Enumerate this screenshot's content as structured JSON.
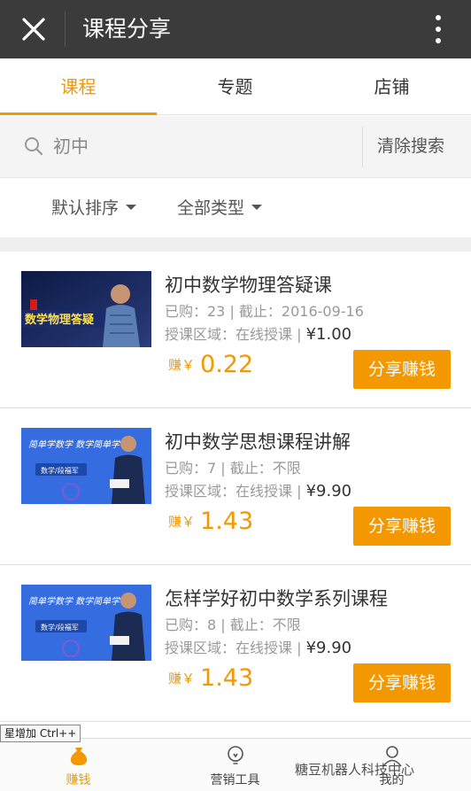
{
  "header": {
    "title": "课程分享",
    "close_icon": "close-icon",
    "more_icon": "more-vertical-icon"
  },
  "tabs": [
    {
      "label": "课程",
      "active": true
    },
    {
      "label": "专题",
      "active": false
    },
    {
      "label": "店铺",
      "active": false
    }
  ],
  "search": {
    "value": "初中",
    "clear_label": "清除搜索"
  },
  "filters": {
    "sort_label": "默认排序",
    "type_label": "全部类型"
  },
  "courses": [
    {
      "title": "初中数学物理答疑课",
      "meta": "已购：23 | 截止：2016-09-16",
      "region": "授课区域：在线授课 | ",
      "price": "¥1.00",
      "earn_label": "赚￥",
      "earn": "0.22",
      "share_label": "分享赚钱",
      "thumb_text": "数学物理答疑"
    },
    {
      "title": "初中数学思想课程讲解",
      "meta": "已购：7 | 截止：不限",
      "region": "授课区域：在线授课 | ",
      "price": "¥9.90",
      "earn_label": "赚￥",
      "earn": "1.43",
      "share_label": "分享赚钱",
      "thumb_text": "简单学数学 数学简单学",
      "thumb_sub": "数学/段福军"
    },
    {
      "title": "怎样学好初中数学系列课程",
      "meta": "已购：8 | 截止：不限",
      "region": "授课区域：在线授课 | ",
      "price": "¥9.90",
      "earn_label": "赚￥",
      "earn": "1.43",
      "share_label": "分享赚钱",
      "thumb_text": "简单学数学 数学简单学",
      "thumb_sub": "数学/段福军"
    }
  ],
  "bottom_nav": [
    {
      "label": "赚钱",
      "icon": "money-bag-icon",
      "active": true
    },
    {
      "label": "营销工具",
      "icon": "lightbulb-icon",
      "active": false
    },
    {
      "label": "我的",
      "icon": "user-icon",
      "active": false
    }
  ],
  "tooltip": "星增加 Ctrl++",
  "watermark": "糖豆机器人科技中心",
  "colors": {
    "accent": "#f39800",
    "topbar": "#3b3b3b"
  }
}
